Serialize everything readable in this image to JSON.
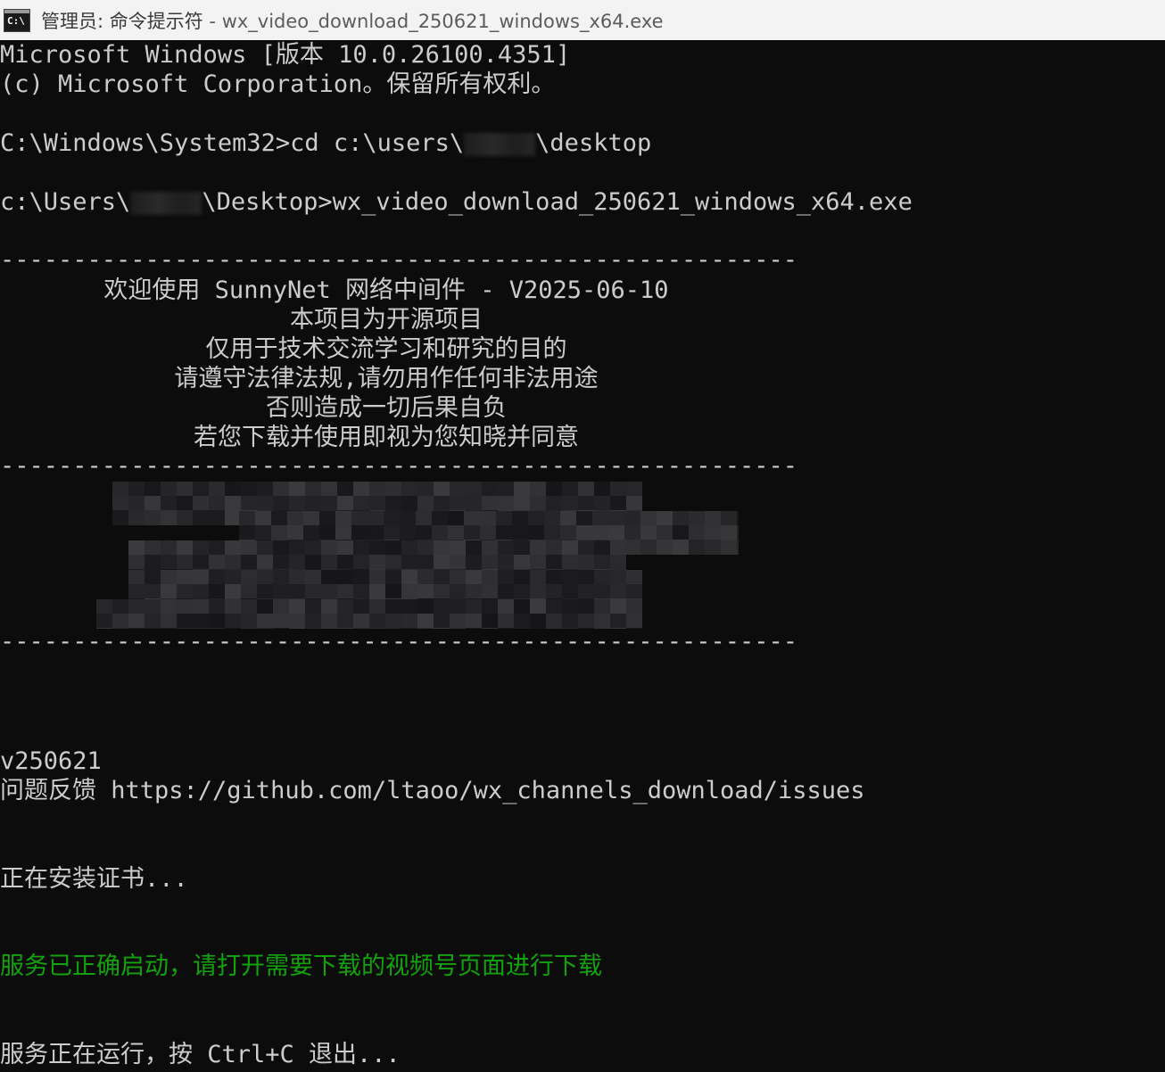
{
  "window": {
    "icon_label": "C:\\",
    "title_prefix": "管理员: 命令提示符",
    "title_separator": " - ",
    "title_program": "wx_video_download_250621_windows_x64.exe"
  },
  "console": {
    "lines": {
      "win_version": "Microsoft Windows [版本 10.0.26100.4351]",
      "copyright": "(c) Microsoft Corporation。保留所有权利。",
      "cmd1_prefix": "C:\\Windows\\System32>cd c:\\users\\",
      "cmd1_suffix": "\\desktop",
      "cmd2_prefix": "c:\\Users\\",
      "cmd2_suffix": "\\Desktop>wx_video_download_250621_windows_x64.exe",
      "separator": "-------------------------------------------------------",
      "banner_1": "欢迎使用 SunnyNet 网络中间件 - V2025-06-10",
      "banner_2": "本项目为开源项目",
      "banner_3": "仅用于技术交流学习和研究的目的",
      "banner_4": "请遵守法律法规,请勿用作任何非法用途",
      "banner_5": "否则造成一切后果自负",
      "banner_6": "若您下载并使用即视为您知晓并同意",
      "version": "v250621",
      "feedback": "问题反馈 https://github.com/ltaoo/wx_channels_download/issues",
      "installing_cert": "正在安装证书...",
      "service_started": "服务已正确启动，请打开需要下载的视频号页面进行下载",
      "service_running": "服务正在运行，按 Ctrl+C 退出..."
    },
    "colors": {
      "background": "#0c0c0c",
      "text": "#cccccc",
      "success": "#13a10e"
    }
  }
}
